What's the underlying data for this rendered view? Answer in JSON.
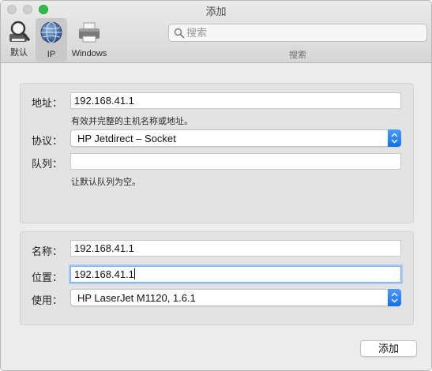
{
  "window": {
    "title": "添加"
  },
  "toolbar": {
    "default_label": "默认",
    "ip_label": "IP",
    "windows_label": "Windows",
    "search": {
      "placeholder": "搜索",
      "caption": "搜索"
    }
  },
  "connection": {
    "address_label": "地址：",
    "address_value": "192.168.41.1",
    "address_hint": "有效并完整的主机名称或地址。",
    "protocol_label": "协议：",
    "protocol_value": "HP Jetdirect – Socket",
    "queue_label": "队列：",
    "queue_value": "",
    "queue_hint": "让默认队列为空。"
  },
  "printer": {
    "name_label": "名称：",
    "name_value": "192.168.41.1",
    "location_label": "位置：",
    "location_value": "192.168.41.1",
    "use_label": "使用：",
    "use_value": "HP LaserJet M1120, 1.6.1"
  },
  "actions": {
    "add_label": "添加"
  },
  "colors": {
    "accent": "#1a73f0",
    "focus_ring": "#a8c8f7",
    "maximize": "#2fbe43"
  }
}
